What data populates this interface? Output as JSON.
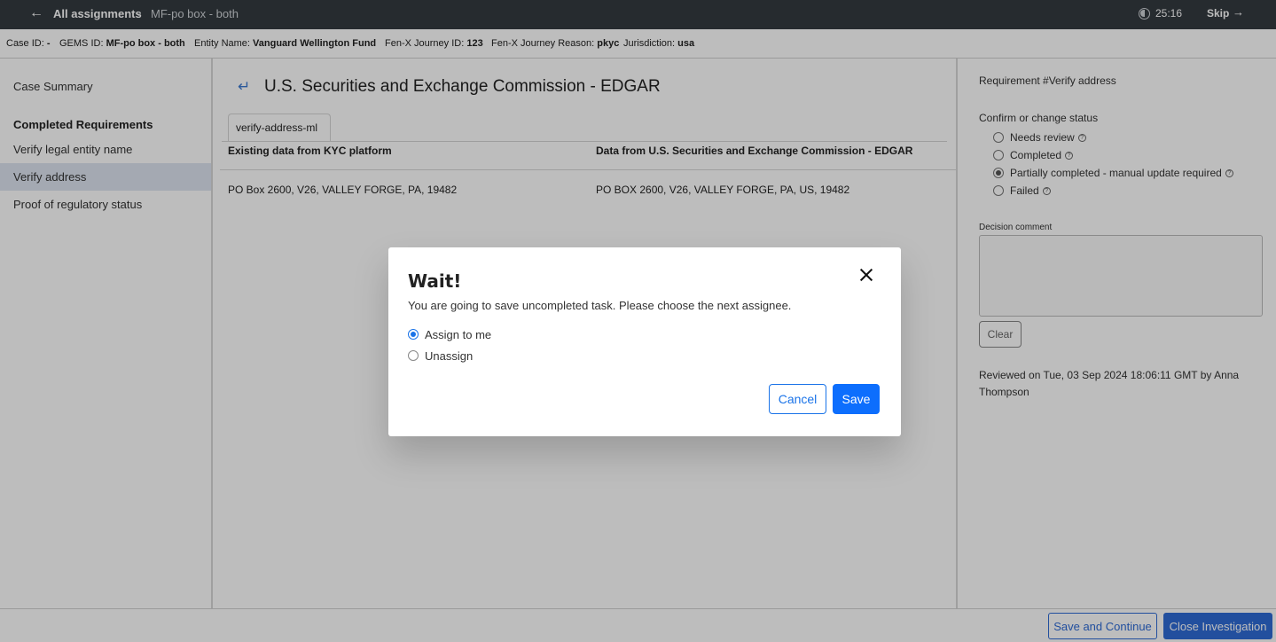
{
  "topbar": {
    "back_icon": "arrow-left-icon",
    "breadcrumb_main": "All assignments",
    "breadcrumb_sep": "›",
    "breadcrumb_current": "MF-po box - both",
    "timer_icon": "timer-icon",
    "timer": "25:16",
    "skip_label": "Skip",
    "skip_icon": "arrow-right-icon"
  },
  "infobar": {
    "case_id_label": "Case ID:",
    "case_id_value": "-",
    "gems_id_label": "GEMS ID:",
    "gems_id_value": "MF-po box - both",
    "entity_label": "Entity Name:",
    "entity_value": "Vanguard Wellington Fund",
    "journey_id_label": "Fen-X Journey ID:",
    "journey_id_value": "123",
    "journey_reason_label": "Fen-X Journey Reason:",
    "journey_reason_value": "pkyc",
    "jurisdiction_label": "Jurisdiction:",
    "jurisdiction_value": "usa"
  },
  "sidebar": {
    "case_summary": "Case Summary",
    "heading": "Completed Requirements",
    "items": [
      {
        "label": "Verify legal entity name"
      },
      {
        "label": "Verify address"
      },
      {
        "label": "Proof of regulatory status"
      }
    ]
  },
  "main": {
    "back_icon": "return-arrow-icon",
    "title": "U.S. Securities and Exchange Commission - EDGAR",
    "tab_label": "verify-address-ml",
    "col_left_header": "Existing data from KYC platform",
    "col_right_header": "Data from U.S. Securities and Exchange Commission - EDGAR",
    "row_left": "PO Box 2600, V26, VALLEY FORGE, PA, 19482",
    "row_right": "PO BOX 2600, V26, VALLEY FORGE, PA, US, 19482"
  },
  "right_panel": {
    "requirement_title": "Requirement #Verify address",
    "confirm_label": "Confirm or change status",
    "status_options": [
      {
        "label": "Needs review",
        "checked": false
      },
      {
        "label": "Completed",
        "checked": false
      },
      {
        "label": "Partially completed - manual update required",
        "checked": true
      },
      {
        "label": "Failed",
        "checked": false
      }
    ],
    "help_icon": "question-circle-icon",
    "decision_comment_label": "Decision comment",
    "decision_comment_value": "",
    "clear_label": "Clear",
    "reviewed_text": "Reviewed on Tue, 03 Sep 2024 18:06:11 GMT by Anna Thompson"
  },
  "footer": {
    "save_continue_label": "Save and Continue",
    "close_investigation_label": "Close Investigation"
  },
  "modal": {
    "title": "Wait!",
    "close_icon": "close-icon",
    "message": "You are going to save uncompleted task. Please choose the next assignee.",
    "options": [
      {
        "label": "Assign to me",
        "checked": true
      },
      {
        "label": "Unassign",
        "checked": false
      }
    ],
    "cancel_label": "Cancel",
    "save_label": "Save"
  }
}
